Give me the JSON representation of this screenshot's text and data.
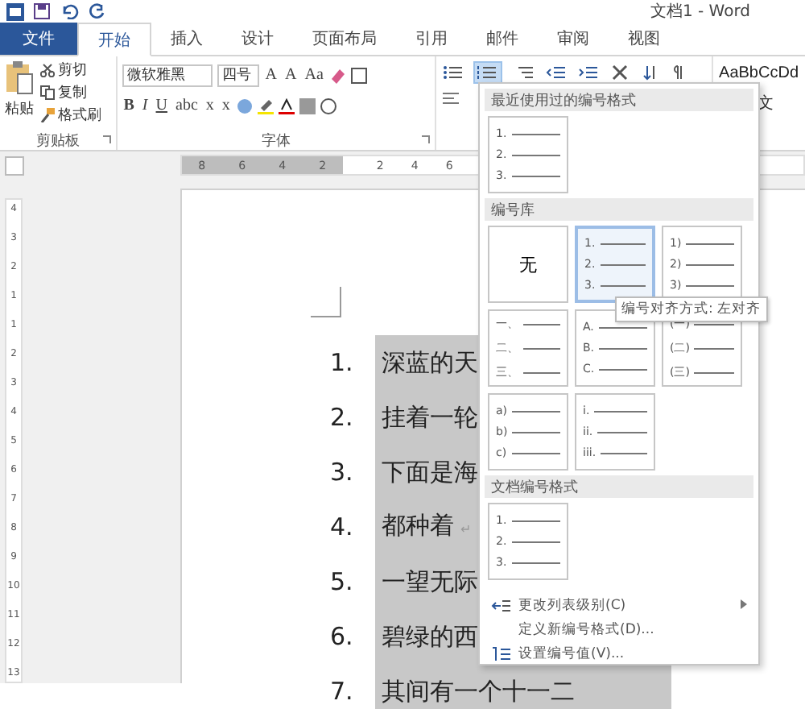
{
  "title_bar": {
    "title": "文档1 - Word"
  },
  "tabs": [
    {
      "label": "文件",
      "kind": "file",
      "selected": false
    },
    {
      "label": "开始",
      "kind": "tab",
      "selected": true
    },
    {
      "label": "插入",
      "kind": "tab",
      "selected": false
    },
    {
      "label": "设计",
      "kind": "tab",
      "selected": false
    },
    {
      "label": "页面布局",
      "kind": "tab",
      "selected": false
    },
    {
      "label": "引用",
      "kind": "tab",
      "selected": false
    },
    {
      "label": "邮件",
      "kind": "tab",
      "selected": false
    },
    {
      "label": "审阅",
      "kind": "tab",
      "selected": false
    },
    {
      "label": "视图",
      "kind": "tab",
      "selected": false
    }
  ],
  "ribbon": {
    "clipboard": {
      "paste": "粘贴",
      "cut": "剪切",
      "copy": "复制",
      "format_painter": "格式刷",
      "group_label": "剪贴板"
    },
    "font": {
      "font_name": "微软雅黑",
      "font_size": "四号",
      "row1": [
        "A",
        "A",
        "Aa"
      ],
      "row2": [
        "B",
        "I",
        "U",
        "abc",
        "x",
        "x"
      ],
      "group_label": "字体"
    },
    "styles": {
      "sample": "AaBbCcDd",
      "name": "文"
    }
  },
  "ruler": {
    "left_marks": [
      "8",
      "6",
      "4",
      "2"
    ],
    "right_marks": [
      "2",
      "4",
      "6"
    ]
  },
  "vertical_ruler": {
    "marks": [
      "4",
      "3",
      "2",
      "1",
      "1",
      "2",
      "3",
      "4",
      "5",
      "6",
      "7",
      "8",
      "9",
      "10",
      "11",
      "12",
      "13"
    ]
  },
  "document": {
    "items": [
      {
        "number": "1.",
        "text": "深蓝的天",
        "selected": true
      },
      {
        "number": "2.",
        "text": "挂着一轮",
        "selected": true
      },
      {
        "number": "3.",
        "text": "下面是海",
        "selected": true
      },
      {
        "number": "4.",
        "text": "都种着",
        "paragraph_mark": "↵",
        "selected": true
      },
      {
        "number": "5.",
        "text": "一望无际",
        "selected": true
      },
      {
        "number": "6.",
        "text": "碧绿的西",
        "selected": true
      },
      {
        "number": "7.",
        "text": "其间有一个十一二",
        "selected": true
      }
    ]
  },
  "numbering_menu": {
    "recent_header": "最近使用过的编号格式",
    "recent": [
      {
        "kind": "list",
        "lines": [
          "1.",
          "2.",
          "3."
        ],
        "selected": false
      }
    ],
    "library_header": "编号库",
    "library": [
      {
        "kind": "none",
        "label": "无",
        "selected": false
      },
      {
        "kind": "list",
        "lines": [
          "1.",
          "2.",
          "3."
        ],
        "selected": true
      },
      {
        "kind": "list",
        "lines": [
          "1)",
          "2)",
          "3)"
        ],
        "selected": false
      },
      {
        "kind": "list",
        "lines": [
          "一、",
          "二、",
          "三、"
        ],
        "selected": false
      },
      {
        "kind": "list",
        "lines": [
          "A.",
          "B.",
          "C."
        ],
        "selected": false
      },
      {
        "kind": "list",
        "lines": [
          "(一)",
          "(二)",
          "(三)"
        ],
        "selected": false
      },
      {
        "kind": "list",
        "lines": [
          "a)",
          "b)",
          "c)"
        ],
        "selected": false
      },
      {
        "kind": "list",
        "lines": [
          "i.",
          "ii.",
          "iii."
        ],
        "selected": false
      }
    ],
    "tooltip": "编号对齐方式: 左对齐",
    "document_header": "文档编号格式",
    "document": [
      {
        "kind": "list",
        "lines": [
          "1.",
          "2.",
          "3."
        ],
        "selected": false
      }
    ],
    "actions": [
      {
        "label": "更改列表级别(C)",
        "kind": "level",
        "submenu": true
      },
      {
        "label": "定义新编号格式(D)...",
        "kind": "plain",
        "submenu": false
      },
      {
        "label": "设置编号值(V)...",
        "kind": "value",
        "submenu": false
      }
    ]
  }
}
